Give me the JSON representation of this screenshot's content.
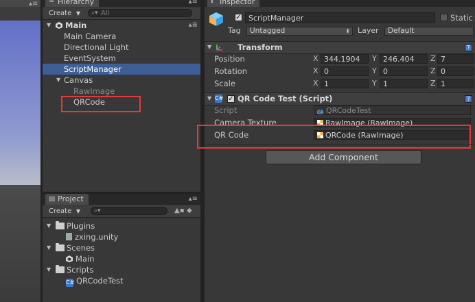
{
  "hierarchy": {
    "tab_label": "Hierarchy",
    "create_label": "Create",
    "search_placeholder": "All",
    "scene": "Main",
    "items": [
      "Main Camera",
      "Directional Light",
      "EventSystem",
      "ScriptManager",
      "Canvas",
      "RawImage",
      "QRCode"
    ]
  },
  "project": {
    "tab_label": "Project",
    "create_label": "Create",
    "items": [
      "Plugins",
      "zxing.unity",
      "Scenes",
      "Main",
      "Scripts",
      "QRCodeTest"
    ]
  },
  "inspector": {
    "tab_label": "Inspector",
    "object_name": "ScriptManager",
    "static_label": "Static",
    "tag_label": "Tag",
    "tag_value": "Untagged",
    "layer_label": "Layer",
    "layer_value": "Default",
    "transform": {
      "title": "Transform",
      "position_label": "Position",
      "rotation_label": "Rotation",
      "scale_label": "Scale",
      "axis_x": "X",
      "axis_y": "Y",
      "axis_z": "Z",
      "position": [
        "344.1904",
        "246.404",
        "7"
      ],
      "rotation": [
        "0",
        "0",
        "0"
      ],
      "scale": [
        "1",
        "1",
        "1"
      ]
    },
    "component": {
      "title": "QR Code Test (Script)",
      "script_label": "Script",
      "script_value": "QRCodeTest",
      "camera_label": "Camera Texture",
      "camera_value": "RawImage (RawImage)",
      "qr_label": "QR Code",
      "qr_value": "QRCode (RawImage)"
    },
    "add_component_label": "Add Component"
  },
  "colors": {
    "selection": "#3e5f96",
    "highlight_box": "#e63a3a",
    "panel_bg": "#383838"
  }
}
